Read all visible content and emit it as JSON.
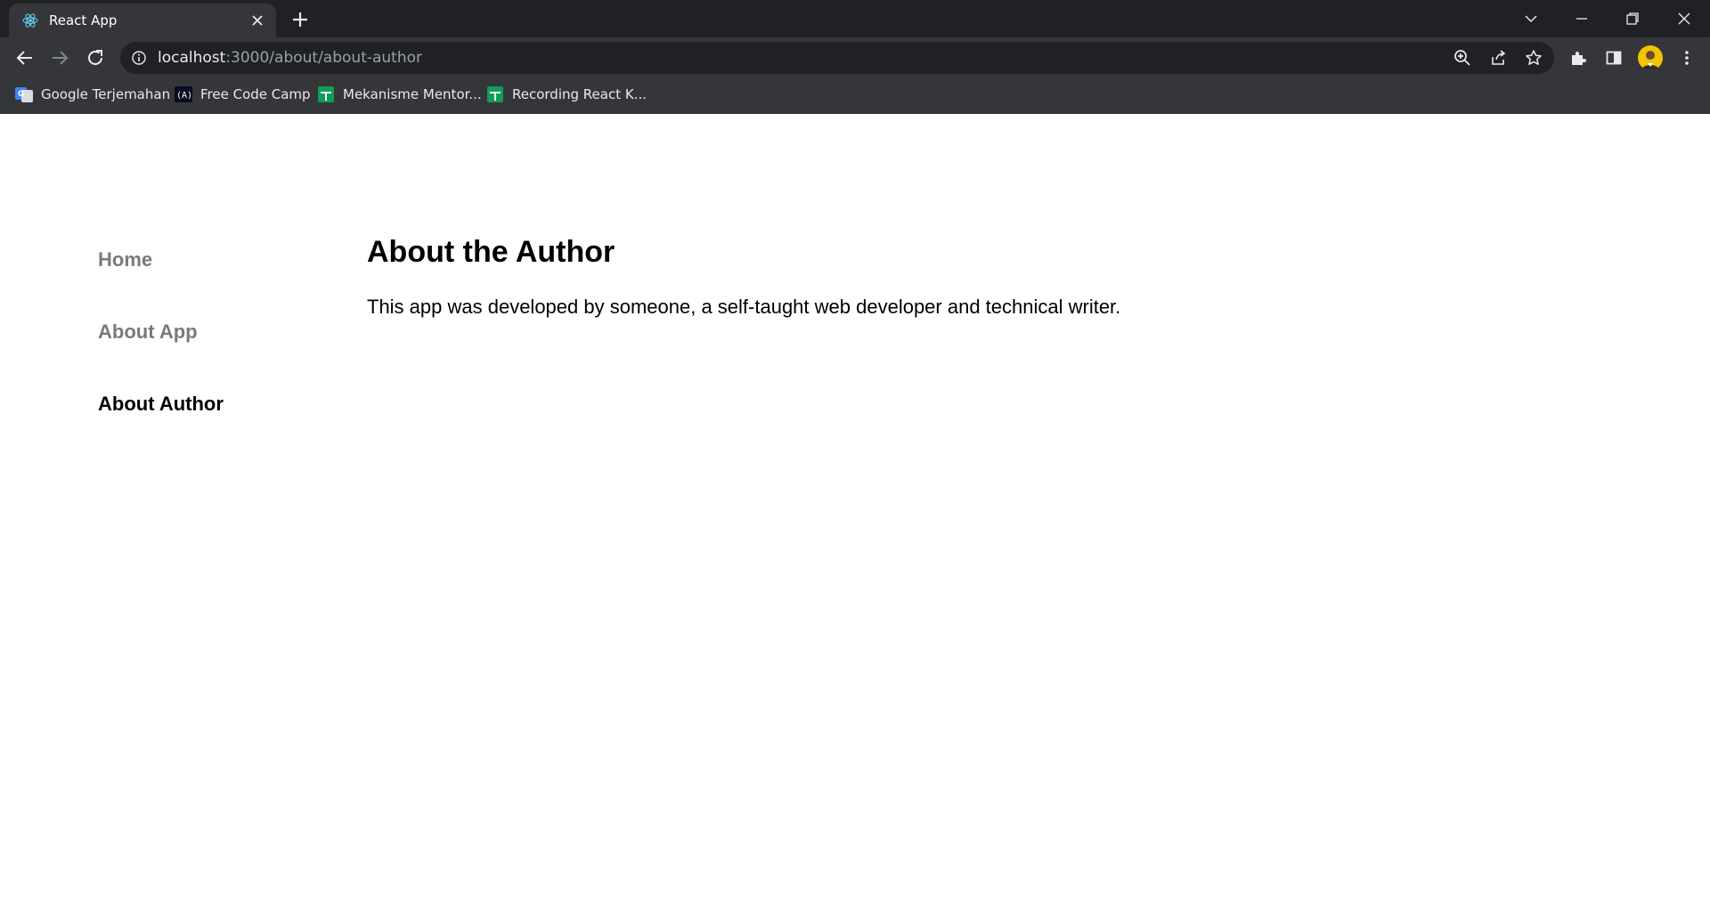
{
  "browser": {
    "tab": {
      "title": "React App",
      "favicon": "react-icon"
    },
    "address": {
      "host": "localhost",
      "path": ":3000/about/about-author"
    },
    "bookmarks": [
      {
        "label": "Google Terjemahan",
        "icon": "google-translate-icon"
      },
      {
        "label": "Free Code Camp",
        "icon": "freecodecamp-icon"
      },
      {
        "label": "Mekanisme Mentor...",
        "icon": "google-sheets-icon"
      },
      {
        "label": "Recording React K...",
        "icon": "google-sheets-icon"
      }
    ]
  },
  "page": {
    "nav": [
      {
        "label": "Home",
        "active": false
      },
      {
        "label": "About App",
        "active": false
      },
      {
        "label": "About Author",
        "active": true
      }
    ],
    "heading": "About the Author",
    "paragraph": "This app was developed by someone, a self-taught web developer and technical writer."
  },
  "colors": {
    "chrome_dark": "#202124",
    "chrome_toolbar": "#35363a",
    "nav_inactive": "#7a7a7a",
    "nav_active": "#000000"
  }
}
